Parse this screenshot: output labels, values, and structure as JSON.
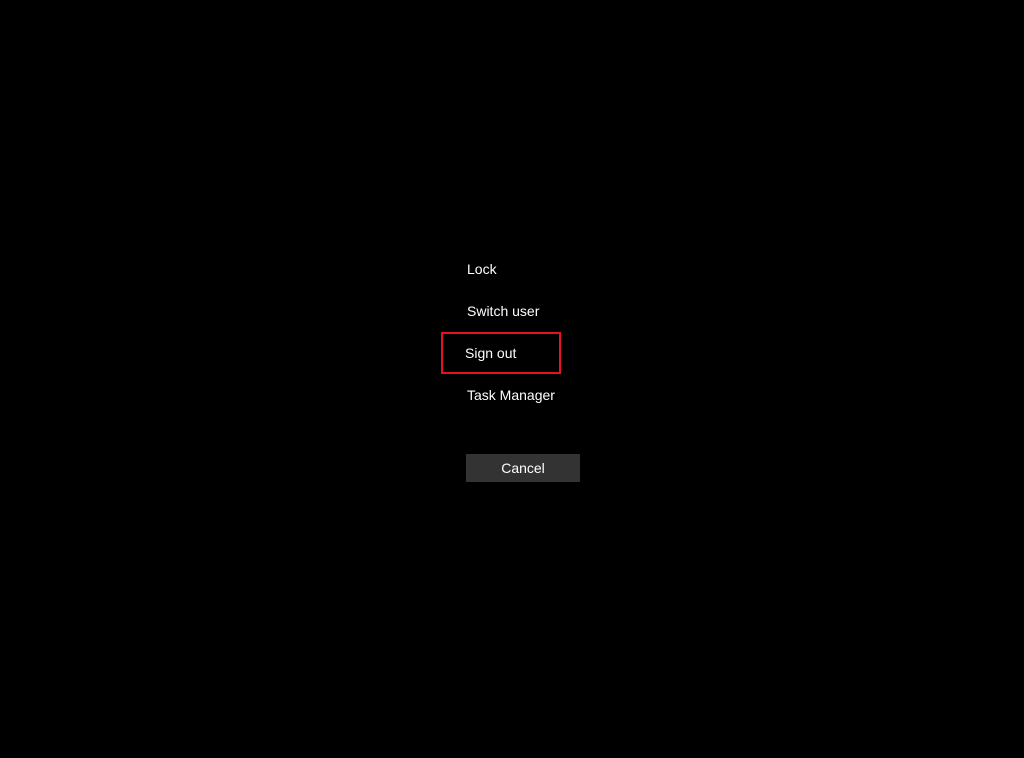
{
  "security_menu": {
    "items": [
      {
        "label": "Lock",
        "highlighted": false
      },
      {
        "label": "Switch user",
        "highlighted": false
      },
      {
        "label": "Sign out",
        "highlighted": true
      },
      {
        "label": "Task Manager",
        "highlighted": false
      }
    ],
    "cancel_label": "Cancel"
  },
  "annotation": {
    "highlight_color": "#e81123"
  }
}
